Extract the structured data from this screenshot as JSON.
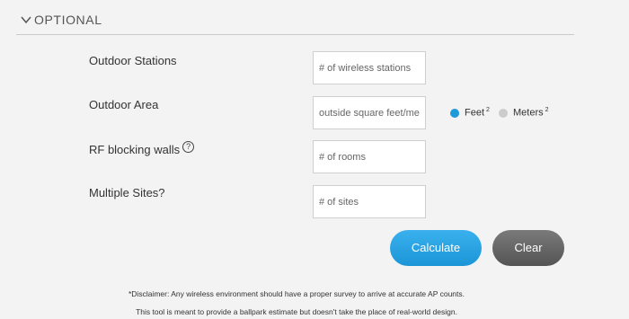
{
  "section": {
    "title": "OPTIONAL",
    "chevron_icon": "chevron-down-icon"
  },
  "rows": [
    {
      "label": "Outdoor Stations",
      "placeholder": "# of wireless stations",
      "value": ""
    },
    {
      "label": "Outdoor Area",
      "placeholder": "outside square feet/meters",
      "value": ""
    },
    {
      "label": "RF blocking walls",
      "placeholder": "# of rooms",
      "value": "",
      "help_icon": "question-circle-icon",
      "help_glyph": "?"
    },
    {
      "label": "Multiple Sites?",
      "placeholder": "# of sites",
      "value": ""
    }
  ],
  "units": {
    "feet": {
      "label": "Feet",
      "sup": "2",
      "selected": true,
      "color": "#1f9ad9"
    },
    "meters": {
      "label": "Meters",
      "sup": "2",
      "selected": false,
      "color": "#cccccc"
    }
  },
  "buttons": {
    "calculate": "Calculate",
    "clear": "Clear"
  },
  "disclaimer": {
    "line1": "*Disclaimer: Any wireless environment should have a proper survey to arrive at accurate AP counts.",
    "line2": "This tool is meant to provide a ballpark estimate but doesn't take the place of real-world design."
  },
  "colors": {
    "accent": "#1f9ad9",
    "clear_button": "#666666",
    "background": "#f3f3f3"
  }
}
